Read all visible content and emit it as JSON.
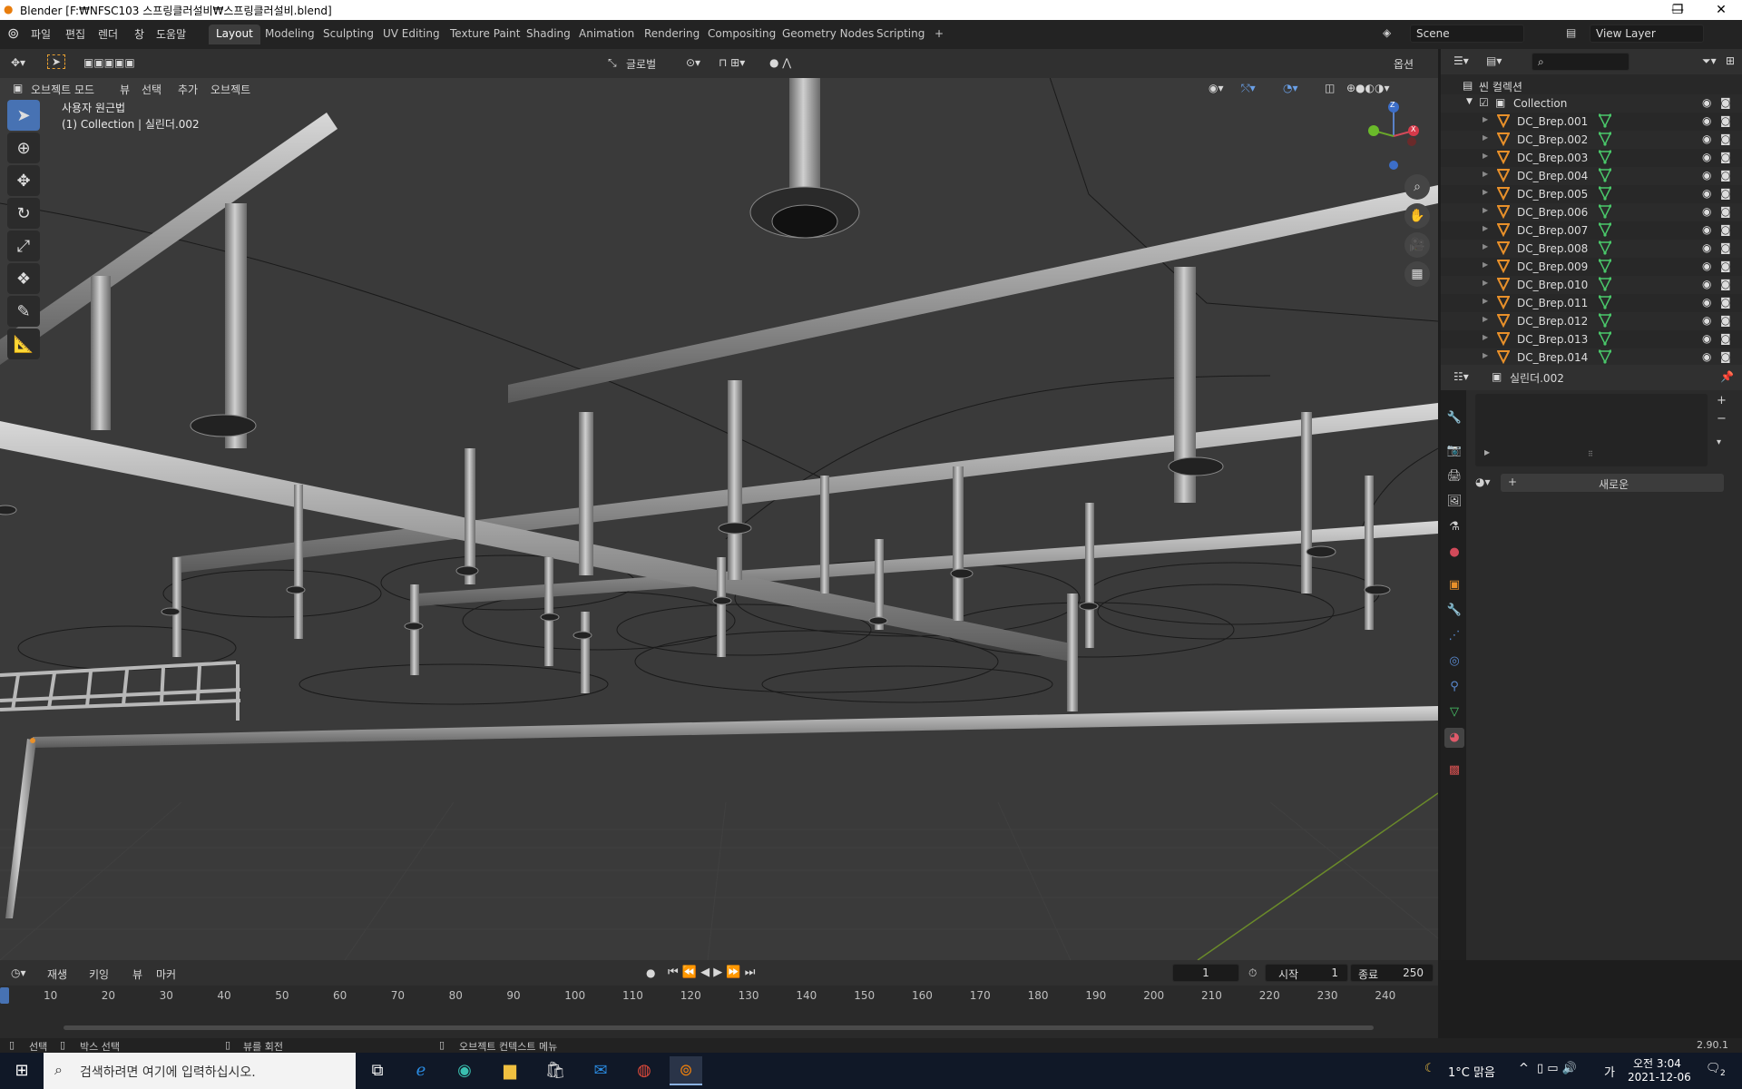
{
  "window": {
    "title": "Blender [F:₩NFSC103 스프링클러설비₩스프링클러설비.blend]",
    "minimize": "—",
    "maximize": "❐",
    "close": "✕"
  },
  "menubar": {
    "items": [
      "파일",
      "편집",
      "렌더",
      "창",
      "도움말"
    ]
  },
  "workspaces": {
    "tabs": [
      "Layout",
      "Modeling",
      "Sculpting",
      "UV Editing",
      "Texture Paint",
      "Shading",
      "Animation",
      "Rendering",
      "Compositing",
      "Geometry Nodes",
      "Scripting"
    ],
    "add": "+"
  },
  "scene": {
    "name": "Scene",
    "view_layer": "View Layer"
  },
  "viewport_header": {
    "mode": "오브젝트 모드",
    "menus": [
      "뷰",
      "선택",
      "추가",
      "오브젝트"
    ],
    "orientation": "글로벌",
    "options": "옵션"
  },
  "viewport_info": {
    "line1": "사용자 원근법",
    "line2": "(1) Collection | 실린더.002"
  },
  "gizmo": {
    "z": "Z",
    "x": "X"
  },
  "outliner": {
    "root": "씬 컬렉션",
    "collection": "Collection",
    "items": [
      "DC_Brep.001",
      "DC_Brep.002",
      "DC_Brep.003",
      "DC_Brep.004",
      "DC_Brep.005",
      "DC_Brep.006",
      "DC_Brep.007",
      "DC_Brep.008",
      "DC_Brep.009",
      "DC_Brep.010",
      "DC_Brep.011",
      "DC_Brep.012",
      "DC_Brep.013",
      "DC_Brep.014"
    ]
  },
  "properties": {
    "object_name": "실린더.002",
    "new_button": "새로운",
    "add": "+",
    "remove": "−"
  },
  "timeline": {
    "menus": [
      "재생",
      "키잉",
      "뷰",
      "마커"
    ],
    "current_frame": "1",
    "start_label": "시작",
    "start_value": "1",
    "end_label": "종료",
    "end_value": "250",
    "ticks": [
      "10",
      "20",
      "30",
      "40",
      "50",
      "60",
      "70",
      "80",
      "90",
      "100",
      "110",
      "120",
      "130",
      "140",
      "150",
      "160",
      "170",
      "180",
      "190",
      "200",
      "210",
      "220",
      "230",
      "240"
    ]
  },
  "statusbar": {
    "select": "선택",
    "box_select": "박스 선택",
    "rotate_view": "뷰를 회전",
    "context_menu": "오브젝트 컨텍스트 메뉴",
    "version": "2.90.1"
  },
  "taskbar": {
    "search_placeholder": "검색하려면 여기에 입력하십시오.",
    "weather": "1°C 맑음",
    "ime": "가",
    "time": "오전 3:04",
    "date": "2021-12-06",
    "notifications": "2"
  }
}
